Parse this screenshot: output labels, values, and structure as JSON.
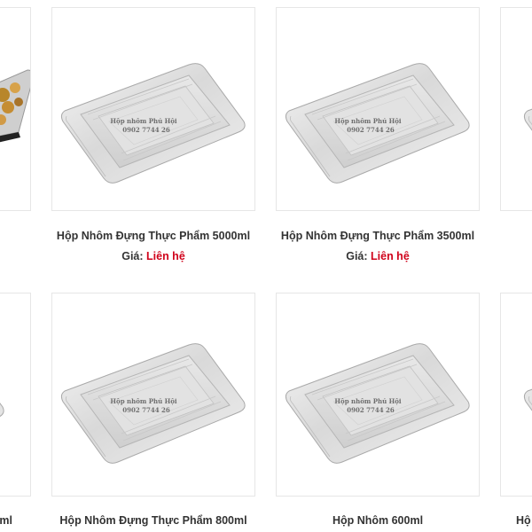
{
  "watermark": {
    "brand": "Hộp nhôm Phú Hội",
    "phone": "0902 7744 26"
  },
  "colors": {
    "price": "#d0021b",
    "title": "#333333",
    "border": "#e6e6e6"
  },
  "row1": {
    "p2": {
      "title": "Hộp Nhôm Đựng Thực Phẩm 5000ml",
      "price_label": "Giá:",
      "price_value": "Liên hệ"
    },
    "p3": {
      "title": "Hộp Nhôm Đựng Thực Phẩm 3500ml",
      "price_label": "Giá:",
      "price_value": "Liên hệ"
    }
  },
  "row2": {
    "p1_title_fragment": "0ml",
    "p2_title": "Hộp Nhôm Đựng Thực Phẩm 800ml",
    "p3_title": "Hộp Nhôm 600ml",
    "p4_title_fragment": "Hộ"
  }
}
